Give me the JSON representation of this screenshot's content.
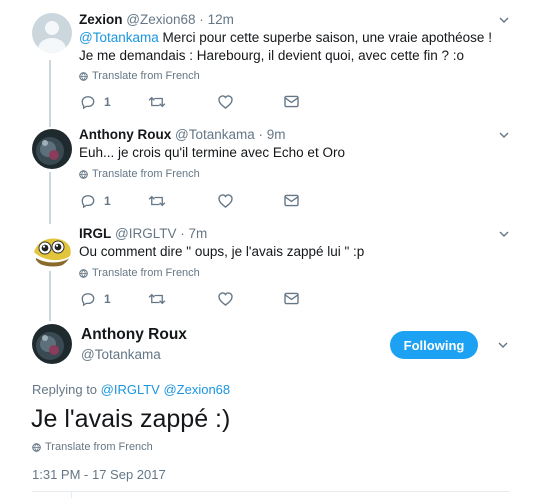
{
  "tweets": [
    {
      "name": "Zexion",
      "handle": "@Zexion68",
      "time": "12m",
      "mention": "@Totankama",
      "text": " Merci pour cette superbe saison, une vraie apothéose ! Je me demandais : Harebourg, il devient quoi, avec cette fin ? :o",
      "translate": "Translate from French",
      "reply_count": "1"
    },
    {
      "name": "Anthony Roux",
      "handle": "@Totankama",
      "time": "9m",
      "text": "Euh... je crois qu'il termine avec Echo et Oro",
      "translate": "Translate from French",
      "reply_count": "1"
    },
    {
      "name": "IRGL",
      "handle": "@IRGLTV",
      "time": "7m",
      "text": "Ou comment dire \" oups, je l'avais zappé lui \" :p",
      "translate": "Translate from French",
      "reply_count": "1"
    }
  ],
  "main": {
    "name": "Anthony Roux",
    "handle": "@Totankama",
    "follow_label": "Following",
    "replying_prefix": "Replying to ",
    "replying_to_1": "@IRGLTV",
    "replying_to_2": "@Zexion68",
    "text": "Je l'avais zappé :)",
    "translate": "Translate from French",
    "timestamp": "1:31 PM - 17 Sep 2017"
  },
  "colors": {
    "accent": "#1da1f2",
    "link": "#1b95e0",
    "muted": "#657786"
  },
  "icons": [
    "reply-icon",
    "retweet-icon",
    "like-icon",
    "dm-icon",
    "globe-icon",
    "chevron-down-icon"
  ]
}
